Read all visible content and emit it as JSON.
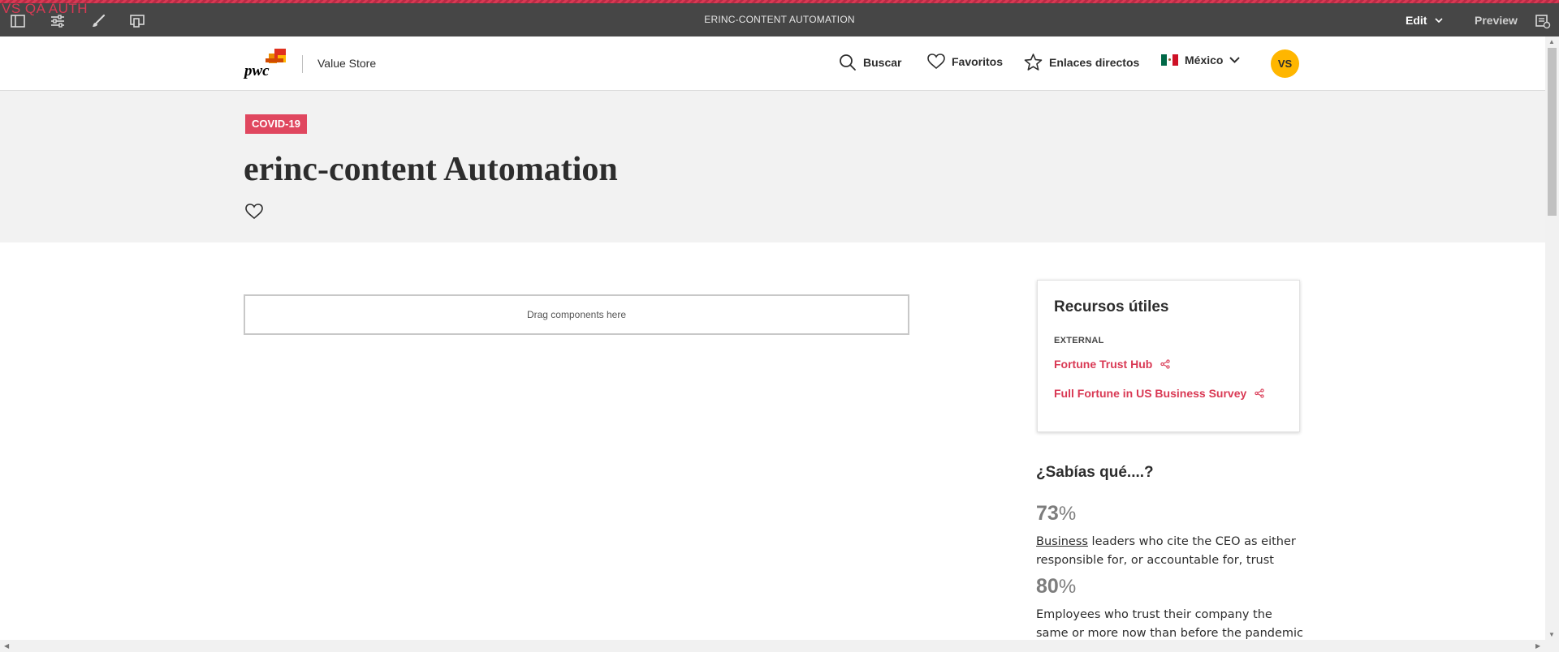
{
  "editor": {
    "env_tag": "VS QA AUTH",
    "page_title": "ERINC-CONTENT AUTOMATION",
    "mode_label": "Edit",
    "preview_label": "Preview",
    "icons": [
      "side-panel-icon",
      "page-properties-icon",
      "style-brush-icon",
      "emulator-icon",
      "page-info-icon"
    ]
  },
  "header": {
    "brand_logo_text": "pwc",
    "brand_name": "Value Store",
    "nav": {
      "search_label": "Buscar",
      "favorites_label": "Favoritos",
      "direct_links_label": "Enlaces directos",
      "country_label": "México"
    },
    "avatar_initials": "VS"
  },
  "hero": {
    "tag": "COVID-19",
    "title": "erinc-content Automation"
  },
  "main": {
    "dropzone_label": "Drag components here"
  },
  "resources": {
    "title": "Recursos útiles",
    "category": "EXTERNAL",
    "links": [
      {
        "label": "Fortune Trust Hub"
      },
      {
        "label": "Full Fortune in US Business Survey"
      }
    ]
  },
  "did_you_know": {
    "title": "¿Sabías qué....?",
    "stats": [
      {
        "value": "73",
        "unit": "%",
        "link_word": "Business",
        "text": " leaders who cite the CEO as either responsible for, or accountable for, trust"
      },
      {
        "value": "80",
        "unit": "%",
        "link_word": "",
        "text": "Employees who trust their company the same or more now than before the pandemic"
      }
    ]
  },
  "colors": {
    "accent": "#d93954",
    "badge": "#e0475f",
    "avatar": "#ffb600",
    "editor_bar": "#464646",
    "hero_bg": "#f2f2f2"
  }
}
